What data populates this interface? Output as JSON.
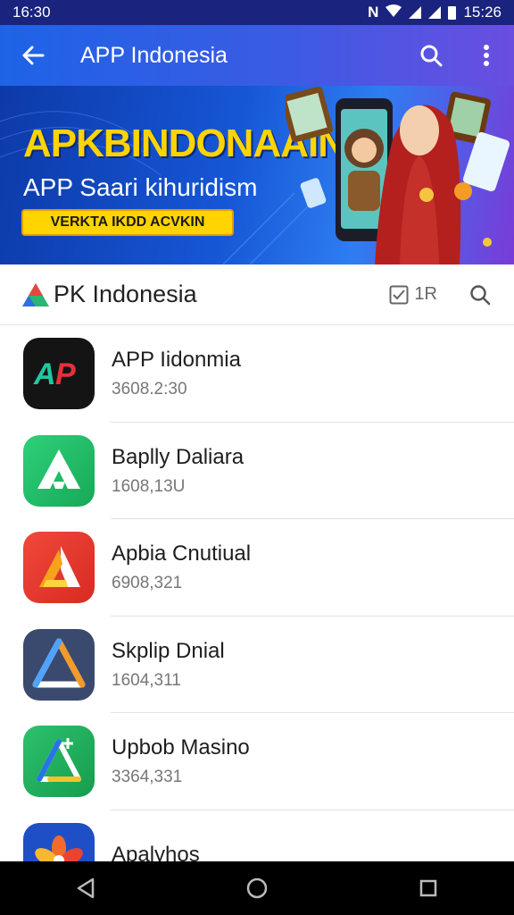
{
  "status": {
    "left_time": "16:30",
    "right_time": "15:26"
  },
  "appbar": {
    "title": "APP Indonesia"
  },
  "banner": {
    "headline": "APKBINDONAAIN",
    "subline": "APP Saari kihuridism",
    "cta": "VERKTA IKDD ACVKIN"
  },
  "header": {
    "brand": "PK Indonesia",
    "brand_prefix": "A",
    "count": "1R"
  },
  "apps": [
    {
      "name": "APP Iidonmia",
      "sub": "3608.2:30",
      "icon": "ap-logo-icon",
      "color": "#141414"
    },
    {
      "name": "Baplly Daliara",
      "sub": "1608,13U",
      "icon": "green-a-icon",
      "color": "#21b763"
    },
    {
      "name": "Apbia Cnutiual",
      "sub": "6908,321",
      "icon": "red-a-icon",
      "color": "#ea3b2e"
    },
    {
      "name": "Skplip Dnial",
      "sub": "1604,311",
      "icon": "blue-a-icon",
      "color": "#3a4a6e"
    },
    {
      "name": "Upbob Masino",
      "sub": "3364,331",
      "icon": "drive-a-icon",
      "color": "#22b25c"
    },
    {
      "name": "Apalyhos",
      "sub": "",
      "icon": "flower-icon",
      "color": "#1f4fc7"
    }
  ]
}
